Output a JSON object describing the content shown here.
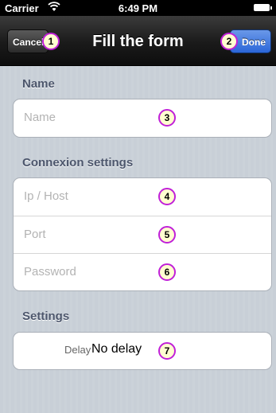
{
  "status_bar": {
    "carrier": "Carrier",
    "wifi_icon": "wifi-icon",
    "time": "6:49 PM",
    "battery_icon": "battery-icon"
  },
  "nav_bar": {
    "title": "Fill the form",
    "cancel_label": "Cancel",
    "done_label": "Done",
    "cancel_badge": "1",
    "done_badge": "2"
  },
  "sections": {
    "name": {
      "header": "Name",
      "field": {
        "placeholder": "Name",
        "value": "",
        "badge": "3"
      }
    },
    "connexion": {
      "header": "Connexion settings",
      "fields": [
        {
          "placeholder": "Ip / Host",
          "value": "",
          "badge": "4"
        },
        {
          "placeholder": "Port",
          "value": "",
          "badge": "5"
        },
        {
          "placeholder": "Password",
          "value": "",
          "badge": "6"
        }
      ]
    },
    "settings": {
      "header": "Settings",
      "delay": {
        "label": "Delay",
        "value": "No delay",
        "badge": "7"
      }
    }
  },
  "colors": {
    "background": "#c5ccd4",
    "navbar": "#1a1a1a",
    "done_button": "#2b66d8",
    "section_header": "#4c566c",
    "placeholder": "#b3b3b3",
    "badge_border": "#c020d8",
    "badge_fill": "#ffffd0"
  }
}
